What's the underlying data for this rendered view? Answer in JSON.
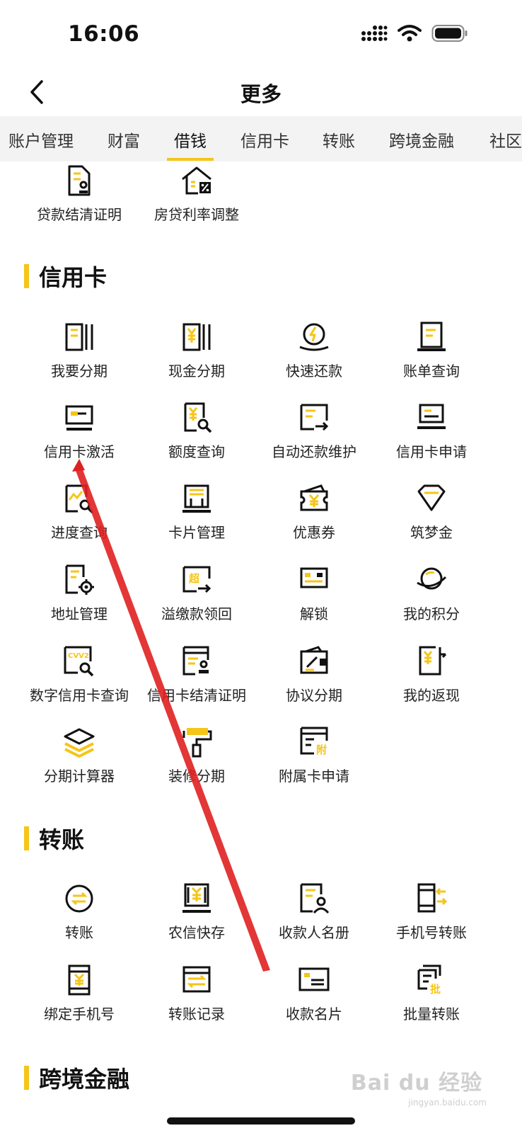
{
  "status": {
    "time": "16:06"
  },
  "nav": {
    "title": "更多"
  },
  "tabs": [
    "账户管理",
    "财富",
    "借钱",
    "信用卡",
    "转账",
    "跨境金融",
    "社区"
  ],
  "active_tab": "借钱",
  "loan_items": [
    {
      "label": "贷款结清证明",
      "icon": "document-stamp-icon"
    },
    {
      "label": "房贷利率调整",
      "icon": "house-percent-icon"
    }
  ],
  "sections": {
    "credit_card": {
      "title": "信用卡",
      "items": [
        {
          "label": "我要分期",
          "icon": "installment-icon"
        },
        {
          "label": "现金分期",
          "icon": "cash-installment-icon"
        },
        {
          "label": "快速还款",
          "icon": "quick-repay-icon"
        },
        {
          "label": "账单查询",
          "icon": "bill-query-icon"
        },
        {
          "label": "信用卡激活",
          "icon": "card-activate-icon"
        },
        {
          "label": "额度查询",
          "icon": "limit-query-icon"
        },
        {
          "label": "自动还款维护",
          "icon": "auto-repay-icon"
        },
        {
          "label": "信用卡申请",
          "icon": "card-apply-icon"
        },
        {
          "label": "进度查询",
          "icon": "progress-query-icon"
        },
        {
          "label": "卡片管理",
          "icon": "card-manage-icon"
        },
        {
          "label": "优惠券",
          "icon": "coupon-icon"
        },
        {
          "label": "筑梦金",
          "icon": "diamond-icon"
        },
        {
          "label": "地址管理",
          "icon": "address-gear-icon"
        },
        {
          "label": "溢缴款领回",
          "icon": "overpay-return-icon"
        },
        {
          "label": "解锁",
          "icon": "unlock-card-icon"
        },
        {
          "label": "我的积分",
          "icon": "planet-icon"
        },
        {
          "label": "数字信用卡查询",
          "icon": "cvv2-search-icon"
        },
        {
          "label": "信用卡结清证明",
          "icon": "card-settle-icon"
        },
        {
          "label": "协议分期",
          "icon": "wallet-pen-icon"
        },
        {
          "label": "我的返现",
          "icon": "cashback-icon"
        },
        {
          "label": "分期计算器",
          "icon": "layers-icon"
        },
        {
          "label": "装修分期",
          "icon": "paint-roller-icon"
        },
        {
          "label": "附属卡申请",
          "icon": "supplementary-card-icon"
        }
      ]
    },
    "transfer": {
      "title": "转账",
      "items": [
        {
          "label": "转账",
          "icon": "transfer-icon"
        },
        {
          "label": "农信快存",
          "icon": "quick-deposit-icon"
        },
        {
          "label": "收款人名册",
          "icon": "payee-list-icon"
        },
        {
          "label": "手机号转账",
          "icon": "phone-transfer-icon"
        },
        {
          "label": "绑定手机号",
          "icon": "bind-phone-icon"
        },
        {
          "label": "转账记录",
          "icon": "transfer-record-icon"
        },
        {
          "label": "收款名片",
          "icon": "payment-card-icon"
        },
        {
          "label": "批量转账",
          "icon": "batch-transfer-icon"
        }
      ]
    },
    "cross_border": {
      "title": "跨境金融"
    }
  },
  "icon_text": {
    "cvv2": "CVV2",
    "chao": "超",
    "fu": "附",
    "pi": "批"
  },
  "colors": {
    "accent": "#f5c518",
    "ink": "#111111",
    "annotation": "#e02020",
    "tab_bg": "#f3f3f3"
  },
  "watermark": {
    "main": "Bai du 经验",
    "sub": "jingyan.baidu.com"
  }
}
